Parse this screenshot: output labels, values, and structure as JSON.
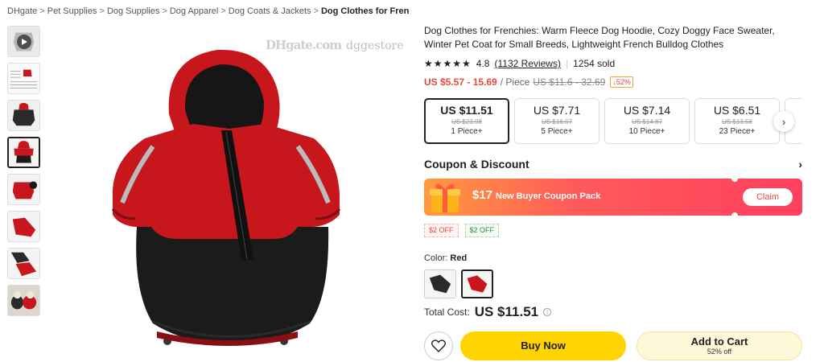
{
  "breadcrumb": {
    "items": [
      "DHgate",
      "Pet Supplies",
      "Dog Supplies",
      "Dog Apparel",
      "Dog Coats & Jackets"
    ],
    "current": "Dog Clothes for Frenchie…",
    "separator": ">"
  },
  "gallery": {
    "watermark_logo": "DHgate.com",
    "watermark_text": "dggestore"
  },
  "product": {
    "title": "Dog Clothes for Frenchies: Warm Fleece Dog Hoodie, Cozy Doggy Face Sweater, Winter Pet Coat for Small Breeds, Lightweight French Bulldog Clothes",
    "stars": "★★★★★",
    "rating": "4.8",
    "reviews": "(1132 Reviews)",
    "sold": "1254 sold",
    "price_range": "US $5.57 - 15.69",
    "per_unit": "/ Piece",
    "old_price_range": "US $11.6 - 32.69",
    "discount": "↓52%"
  },
  "tiers": [
    {
      "price": "US $11.51",
      "old": "US $23.98",
      "qty": "1 Piece+"
    },
    {
      "price": "US $7.71",
      "old": "US $16.07",
      "qty": "5 Piece+"
    },
    {
      "price": "US $7.14",
      "old": "US $14.87",
      "qty": "10 Piece+"
    },
    {
      "price": "US $6.51",
      "old": "US $13.56",
      "qty": "23 Piece+"
    }
  ],
  "coupon": {
    "section_title": "Coupon & Discount",
    "amount": "$17",
    "label": "New Buyer Coupon Pack",
    "claim": "Claim",
    "tags": [
      "$2 OFF",
      "$2 OFF"
    ]
  },
  "color": {
    "label": "Color:",
    "selected": "Red"
  },
  "total": {
    "label": "Total Cost:",
    "value": "US $11.51"
  },
  "actions": {
    "buy_now": "Buy Now",
    "add_to_cart": "Add to Cart",
    "cart_sub": "52% off"
  },
  "colors": {
    "price_red": "#e8483a",
    "buy_yellow": "#ffd400",
    "coat_red": "#c8161d"
  }
}
